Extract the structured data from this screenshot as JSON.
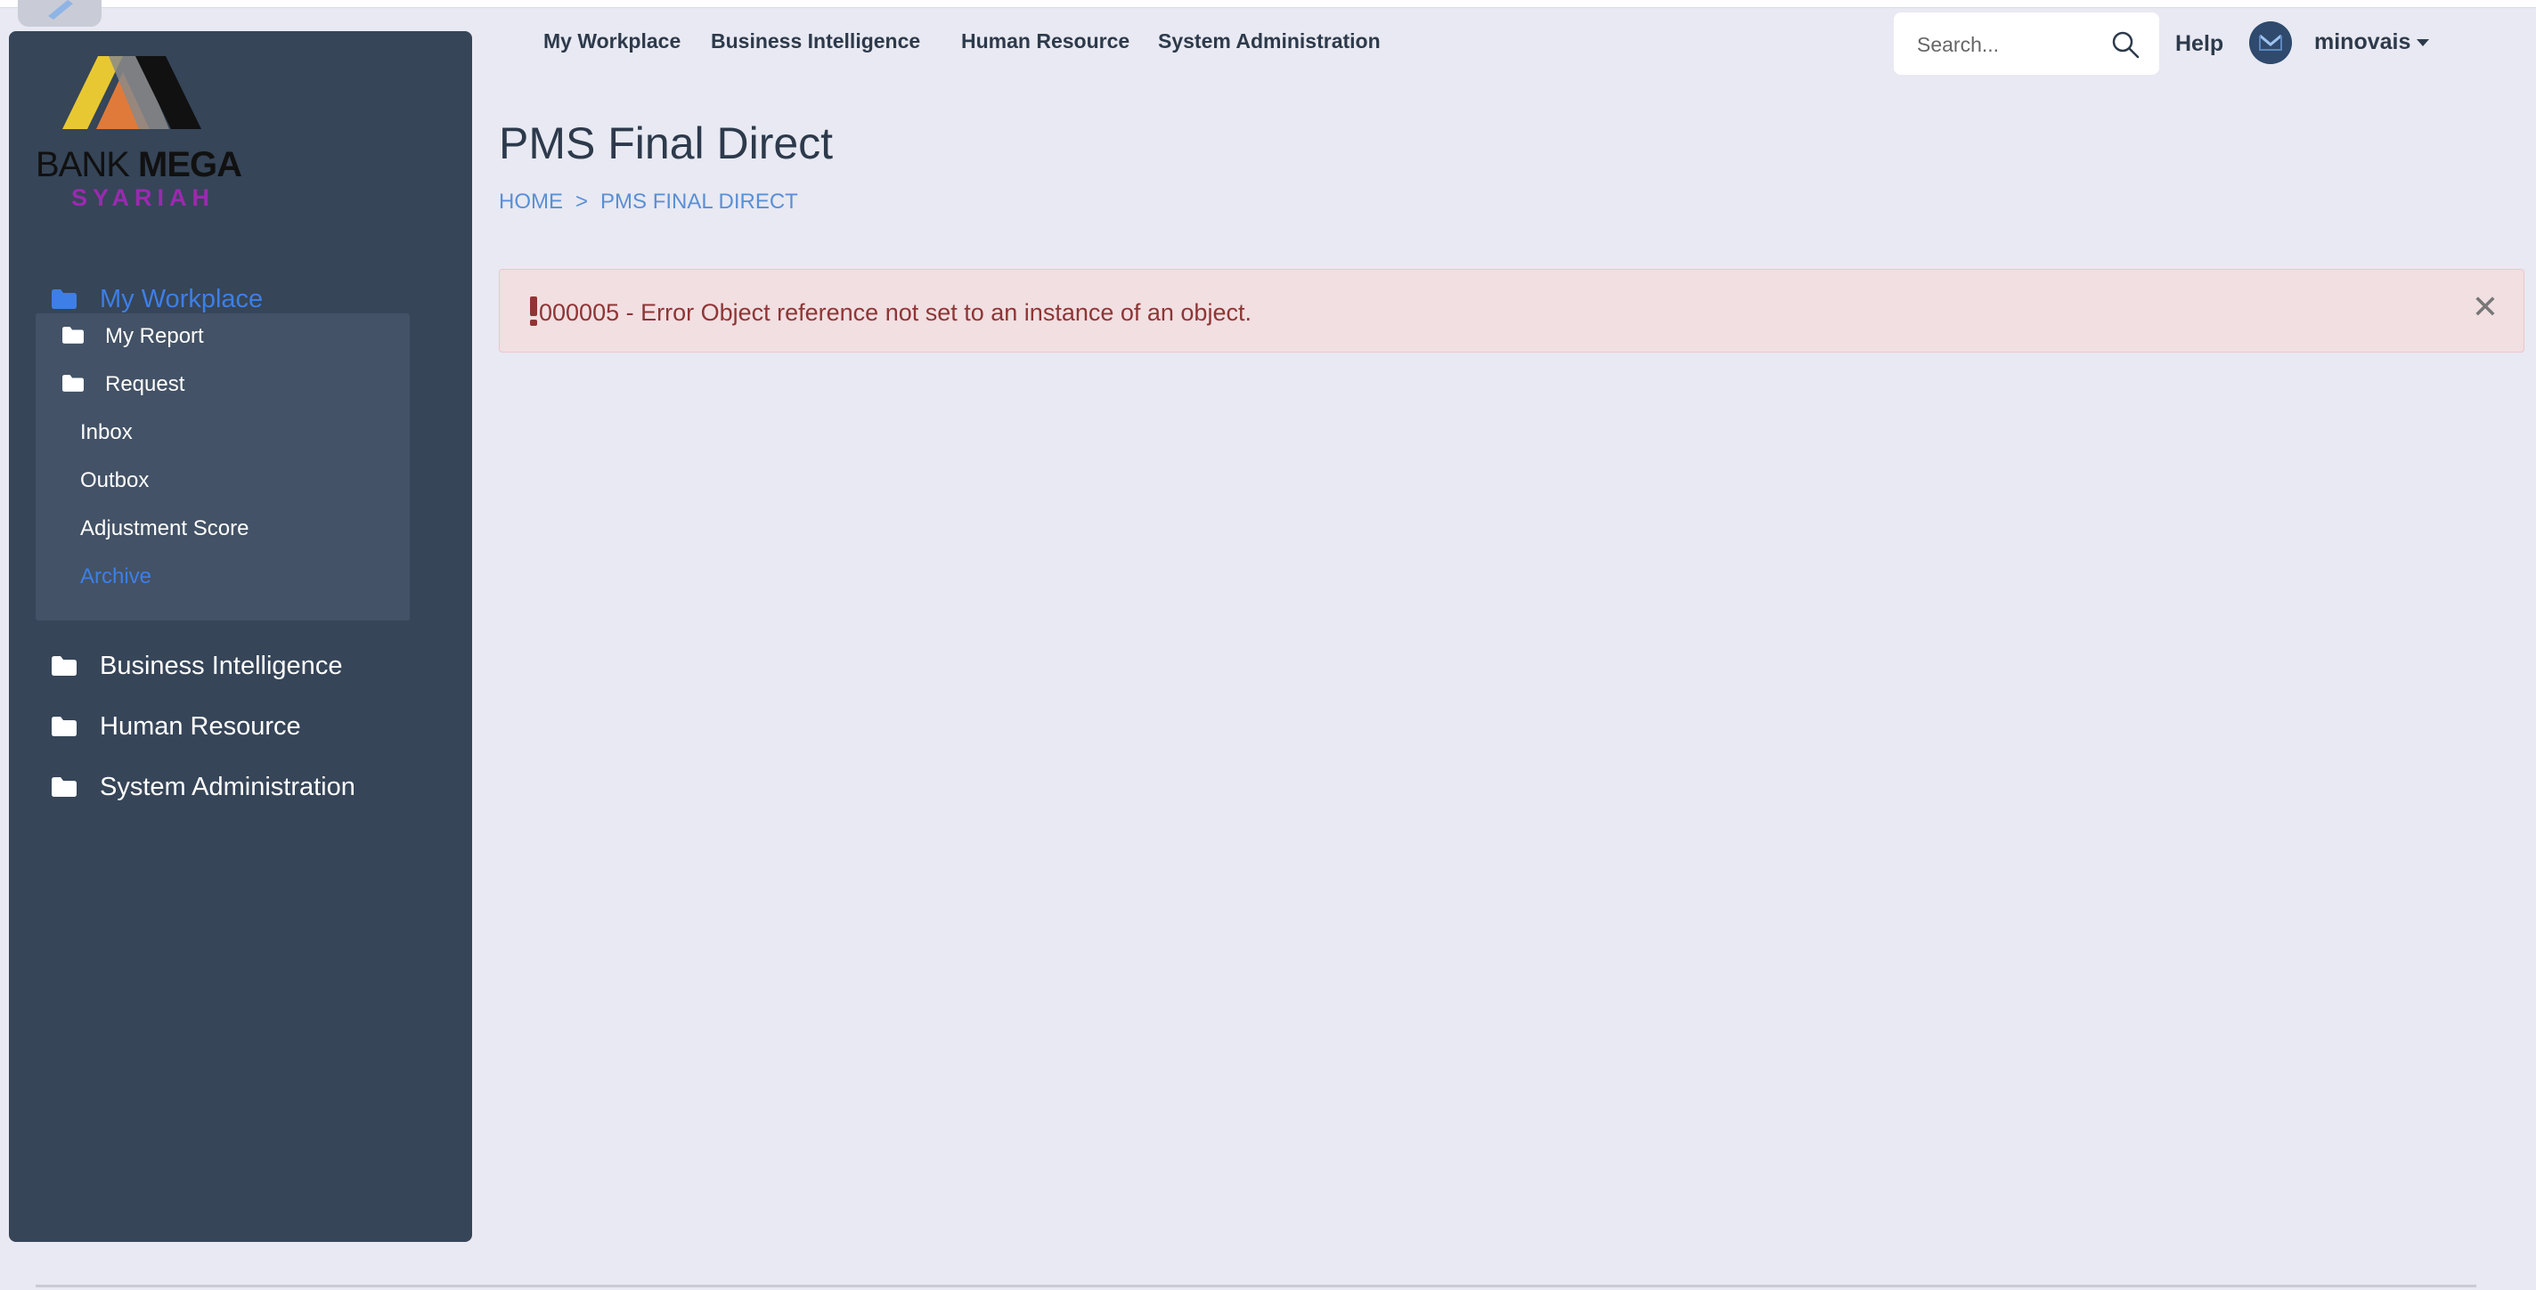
{
  "header": {
    "nav": [
      "My Workplace",
      "Business Intelligence",
      "Human Resource",
      "System Administration"
    ],
    "search_placeholder": "Search...",
    "help_label": "Help",
    "username": "minovais"
  },
  "logo": {
    "line1_regular": "BANK ",
    "line1_bold": "MEGA",
    "line2": "SYARIAH"
  },
  "sidebar": {
    "top_items": [
      {
        "label": "My Workplace",
        "active": true
      },
      {
        "label": "Business Intelligence"
      },
      {
        "label": "Human Resource"
      },
      {
        "label": "System Administration"
      }
    ],
    "sub_items": [
      "My Report",
      "Request"
    ],
    "leaf_items": [
      "Inbox",
      "Outbox",
      "Adjustment Score",
      "Archive"
    ]
  },
  "page": {
    "title": "PMS Final Direct",
    "breadcrumb": [
      "HOME",
      ">",
      "PMS FINAL DIRECT"
    ]
  },
  "alert": {
    "message": "000005 - Error Object reference not set to an instance of an object.",
    "close_symbol": "✕"
  },
  "colors": {
    "background": "#e8e9f2",
    "sidebar": "#364558",
    "active_link": "#3d7fe6",
    "alert_bg": "#f1dfe2",
    "alert_text": "#8f3535"
  }
}
